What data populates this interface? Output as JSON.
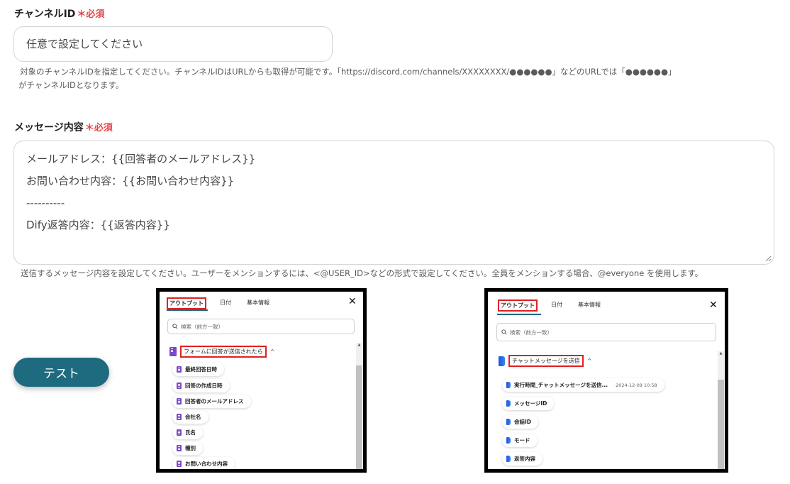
{
  "channel_field": {
    "label": "チャンネルID",
    "required": "＊必須",
    "placeholder": "任意で設定してください",
    "help_line1": "対象のチャンネルIDを指定してください。チャンネルIDはURLからも取得が可能です。「https://discord.com/channels/XXXXXXXX/●●●●●●」などのURLでは「●●●●●●」",
    "help_line2": "がチャンネルIDとなります。"
  },
  "message_field": {
    "label": "メッセージ内容",
    "required": "＊必須",
    "lines": [
      "メールアドレス：{{回答者のメールアドレス}}",
      "お問い合わせ内容：{{お問い合わせ内容}}",
      "----------",
      "Dify返答内容：{{返答内容}}"
    ],
    "help": "送信するメッセージ内容を設定してください。ユーザーをメンションするには、<@USER_ID>などの形式で設定してください。全員をメンションする場合、@everyone を使用します。"
  },
  "test_button": {
    "label": "テスト"
  },
  "panel_forms": {
    "tabs": [
      "アウトプット",
      "日付",
      "基本情報"
    ],
    "search_placeholder": "検索（前方一致）",
    "group_title": "フォームに回答が送信されたら",
    "items": [
      "最終回答日時",
      "回答の作成日時",
      "回答者のメールアドレス",
      "会社名",
      "氏名",
      "種別",
      "お問い合わせ内容"
    ]
  },
  "panel_dify": {
    "tabs": [
      "アウトプット",
      "日付",
      "基本情報"
    ],
    "search_placeholder": "検索（前方一致）",
    "group_title": "チャットメッセージを送信",
    "items": [
      "実行時間_チャットメッセージを送信...",
      "メッセージID",
      "会話ID",
      "モード",
      "返答内容"
    ],
    "first_item_meta": "2024-12-09 10:58"
  },
  "icons": {
    "close": "close-icon",
    "search": "search-icon",
    "chevron": "chevron-up-icon"
  },
  "colors": {
    "accent": "#1e6a7f",
    "required": "#e5484d",
    "highlight": "#e02020"
  }
}
